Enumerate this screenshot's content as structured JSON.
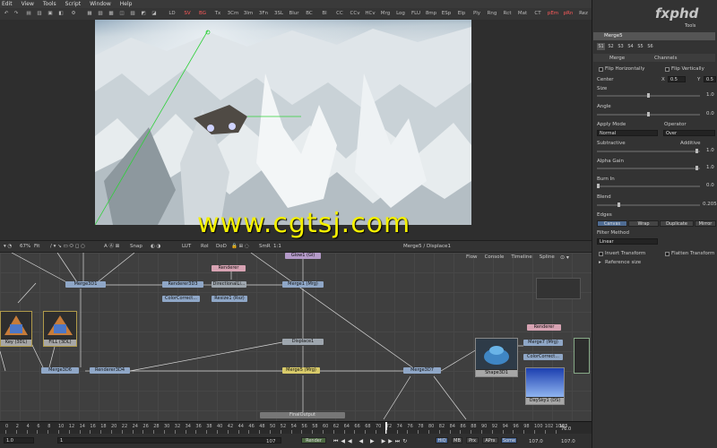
{
  "menu": [
    "Edit",
    "View",
    "Tools",
    "Script",
    "Window",
    "Help"
  ],
  "toolbar": {
    "buttons": [
      "LD",
      "SV",
      "BG",
      "Tx",
      "3Cm",
      "3Im",
      "3Fn",
      "3SL",
      "Blur",
      "BC",
      "Bl",
      "CC",
      "CCv",
      "HCv",
      "Mrg",
      "Log",
      "FLU",
      "8mp",
      "ESp",
      "Elp",
      "Ply",
      "Rng",
      "Rct",
      "Mat",
      "CT",
      "pEm",
      "pRn",
      "Rez"
    ],
    "hot": [
      "SV",
      "BG",
      "pEm",
      "pRn"
    ]
  },
  "brand": "fxphd",
  "tools_label": "Tools",
  "watermark": "www.cgtsj.com",
  "viewer_bar": {
    "zoom": "67%",
    "fit": "Fit",
    "snap": "Snap",
    "lut": "LUT",
    "roi": "RoI",
    "dod": "DoD",
    "smr": "SmR",
    "ratio": "1:1",
    "title": "Merge5 / Displace1"
  },
  "flow_tabs": [
    "Flow",
    "Console",
    "Timeline",
    "Spline"
  ],
  "nodes": {
    "merge3d1": "Merge3D1",
    "renderer3d3": "Renderer3D3",
    "renderer_top": "Renderer",
    "directional": "DirectionalLi...",
    "colorcorrect_a": "ColorCorrect...",
    "resize": "Resize1 (Rsz)",
    "glow": "Glow1 (Gl)",
    "merge_mrg": "Merge1 (Mrg)",
    "displace": "Displace1",
    "merge5": "Merge5 (Mrg)",
    "merge3d6": "Merge3D6",
    "renderer3d4": "Renderer3D4",
    "merge3d7": "Merge3D7",
    "shape3d": "Shape3D1",
    "renderer_right": "Renderer",
    "merge7": "Merge7 (Mrg)",
    "colorcorrect_b": "ColorCorrect...",
    "daysky": "DaySky1 (DS)",
    "finaloutput": "FinalOutput",
    "key_thumb": "Key (3DL)",
    "fill_thumb": "FILL (3DL)"
  },
  "timeline": {
    "ticks": [
      "0",
      "2",
      "4",
      "6",
      "8",
      "10",
      "12",
      "14",
      "16",
      "18",
      "20",
      "22",
      "24",
      "26",
      "28",
      "30",
      "32",
      "34",
      "36",
      "38",
      "40",
      "42",
      "44",
      "46",
      "48",
      "50",
      "52",
      "54",
      "56",
      "58",
      "60",
      "62",
      "64",
      "66",
      "68",
      "70",
      "72",
      "74",
      "76",
      "78",
      "80",
      "82",
      "84",
      "86",
      "88",
      "90",
      "92",
      "94",
      "96",
      "98",
      "100",
      "102",
      "104"
    ],
    "end_label": "105",
    "current": "76.0",
    "start_value": "1.0",
    "frame_value": "1",
    "render_label": "Render",
    "end_value_a": "107",
    "hq": "HiQ",
    "mb": "MB",
    "prx": "Prx",
    "aprx": "APrx",
    "some": "Some",
    "time_a": "107.0",
    "time_b": "107.0"
  },
  "panel": {
    "node_name": "Merge5",
    "tabs": [
      "S1",
      "S2",
      "S3",
      "S4",
      "S5",
      "S6"
    ],
    "subtabs": [
      "Merge",
      "Channels"
    ],
    "flip_h": "Flip Horizontally",
    "flip_v": "Flip Vertically",
    "center": "Center",
    "center_x_label": "X",
    "center_x": "0.5",
    "center_y_label": "Y",
    "center_y": "0.5",
    "size": "Size",
    "size_val": "1.0",
    "angle": "Angle",
    "angle_val": "0.0",
    "apply_mode": "Apply Mode",
    "apply_mode_val": "Normal",
    "operator": "Operator",
    "operator_val": "Over",
    "subtractive": "Subtractive",
    "additive": "Additive",
    "sa_val": "1.0",
    "alpha_gain": "Alpha Gain",
    "alpha_gain_val": "1.0",
    "burn_in": "Burn In",
    "burn_in_val": "0.0",
    "blend": "Blend",
    "blend_val": "0.205",
    "edges": "Edges",
    "edge_buttons": [
      "Canvas",
      "Wrap",
      "Duplicate",
      "Mirror"
    ],
    "filter_method": "Filter Method",
    "filter_val": "Linear",
    "invert_transform": "Invert Transform",
    "flatten_transform": "Flatten Transform",
    "reference_size": "Reference size"
  }
}
